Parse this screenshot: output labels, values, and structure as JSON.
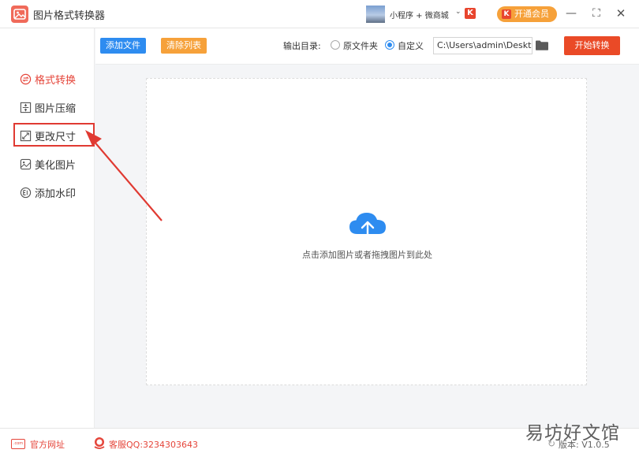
{
  "app": {
    "title": "图片格式转换器",
    "mini_program_text": "小程序 + 微商城",
    "vip_label": "开通会员",
    "vip_icon_letter": "K",
    "mini_icon_letter": "K"
  },
  "window_controls": {
    "minimize": "—",
    "maximize": "⛶",
    "close": "✕"
  },
  "sidebar": {
    "items": [
      {
        "label": "格式转换",
        "icon": "format-convert-icon",
        "active": true
      },
      {
        "label": "图片压缩",
        "icon": "compress-icon",
        "active": false
      },
      {
        "label": "更改尺寸",
        "icon": "resize-icon",
        "active": false
      },
      {
        "label": "美化图片",
        "icon": "beautify-icon",
        "active": false
      },
      {
        "label": "添加水印",
        "icon": "watermark-icon",
        "active": false
      }
    ]
  },
  "toolbar": {
    "add_file": "添加文件",
    "clear_list": "清除列表",
    "output_label": "输出目录:",
    "radio_original": "原文件夹",
    "radio_custom": "自定义",
    "output_path": "C:\\Users\\admin\\Deskto",
    "start": "开始转换"
  },
  "dropzone": {
    "hint": "点击添加图片或者拖拽图片到此处"
  },
  "footer": {
    "site_icon_text": ".com",
    "site_link": "官方网址",
    "qq": "客服QQ:3234303643",
    "version": "版本: V1.0.5"
  },
  "watermark": "易坊好文馆",
  "colors": {
    "accent_red": "#e5453a",
    "primary_blue": "#2e8cf0",
    "orange": "#f6a13a",
    "start_red": "#ea4a27"
  }
}
